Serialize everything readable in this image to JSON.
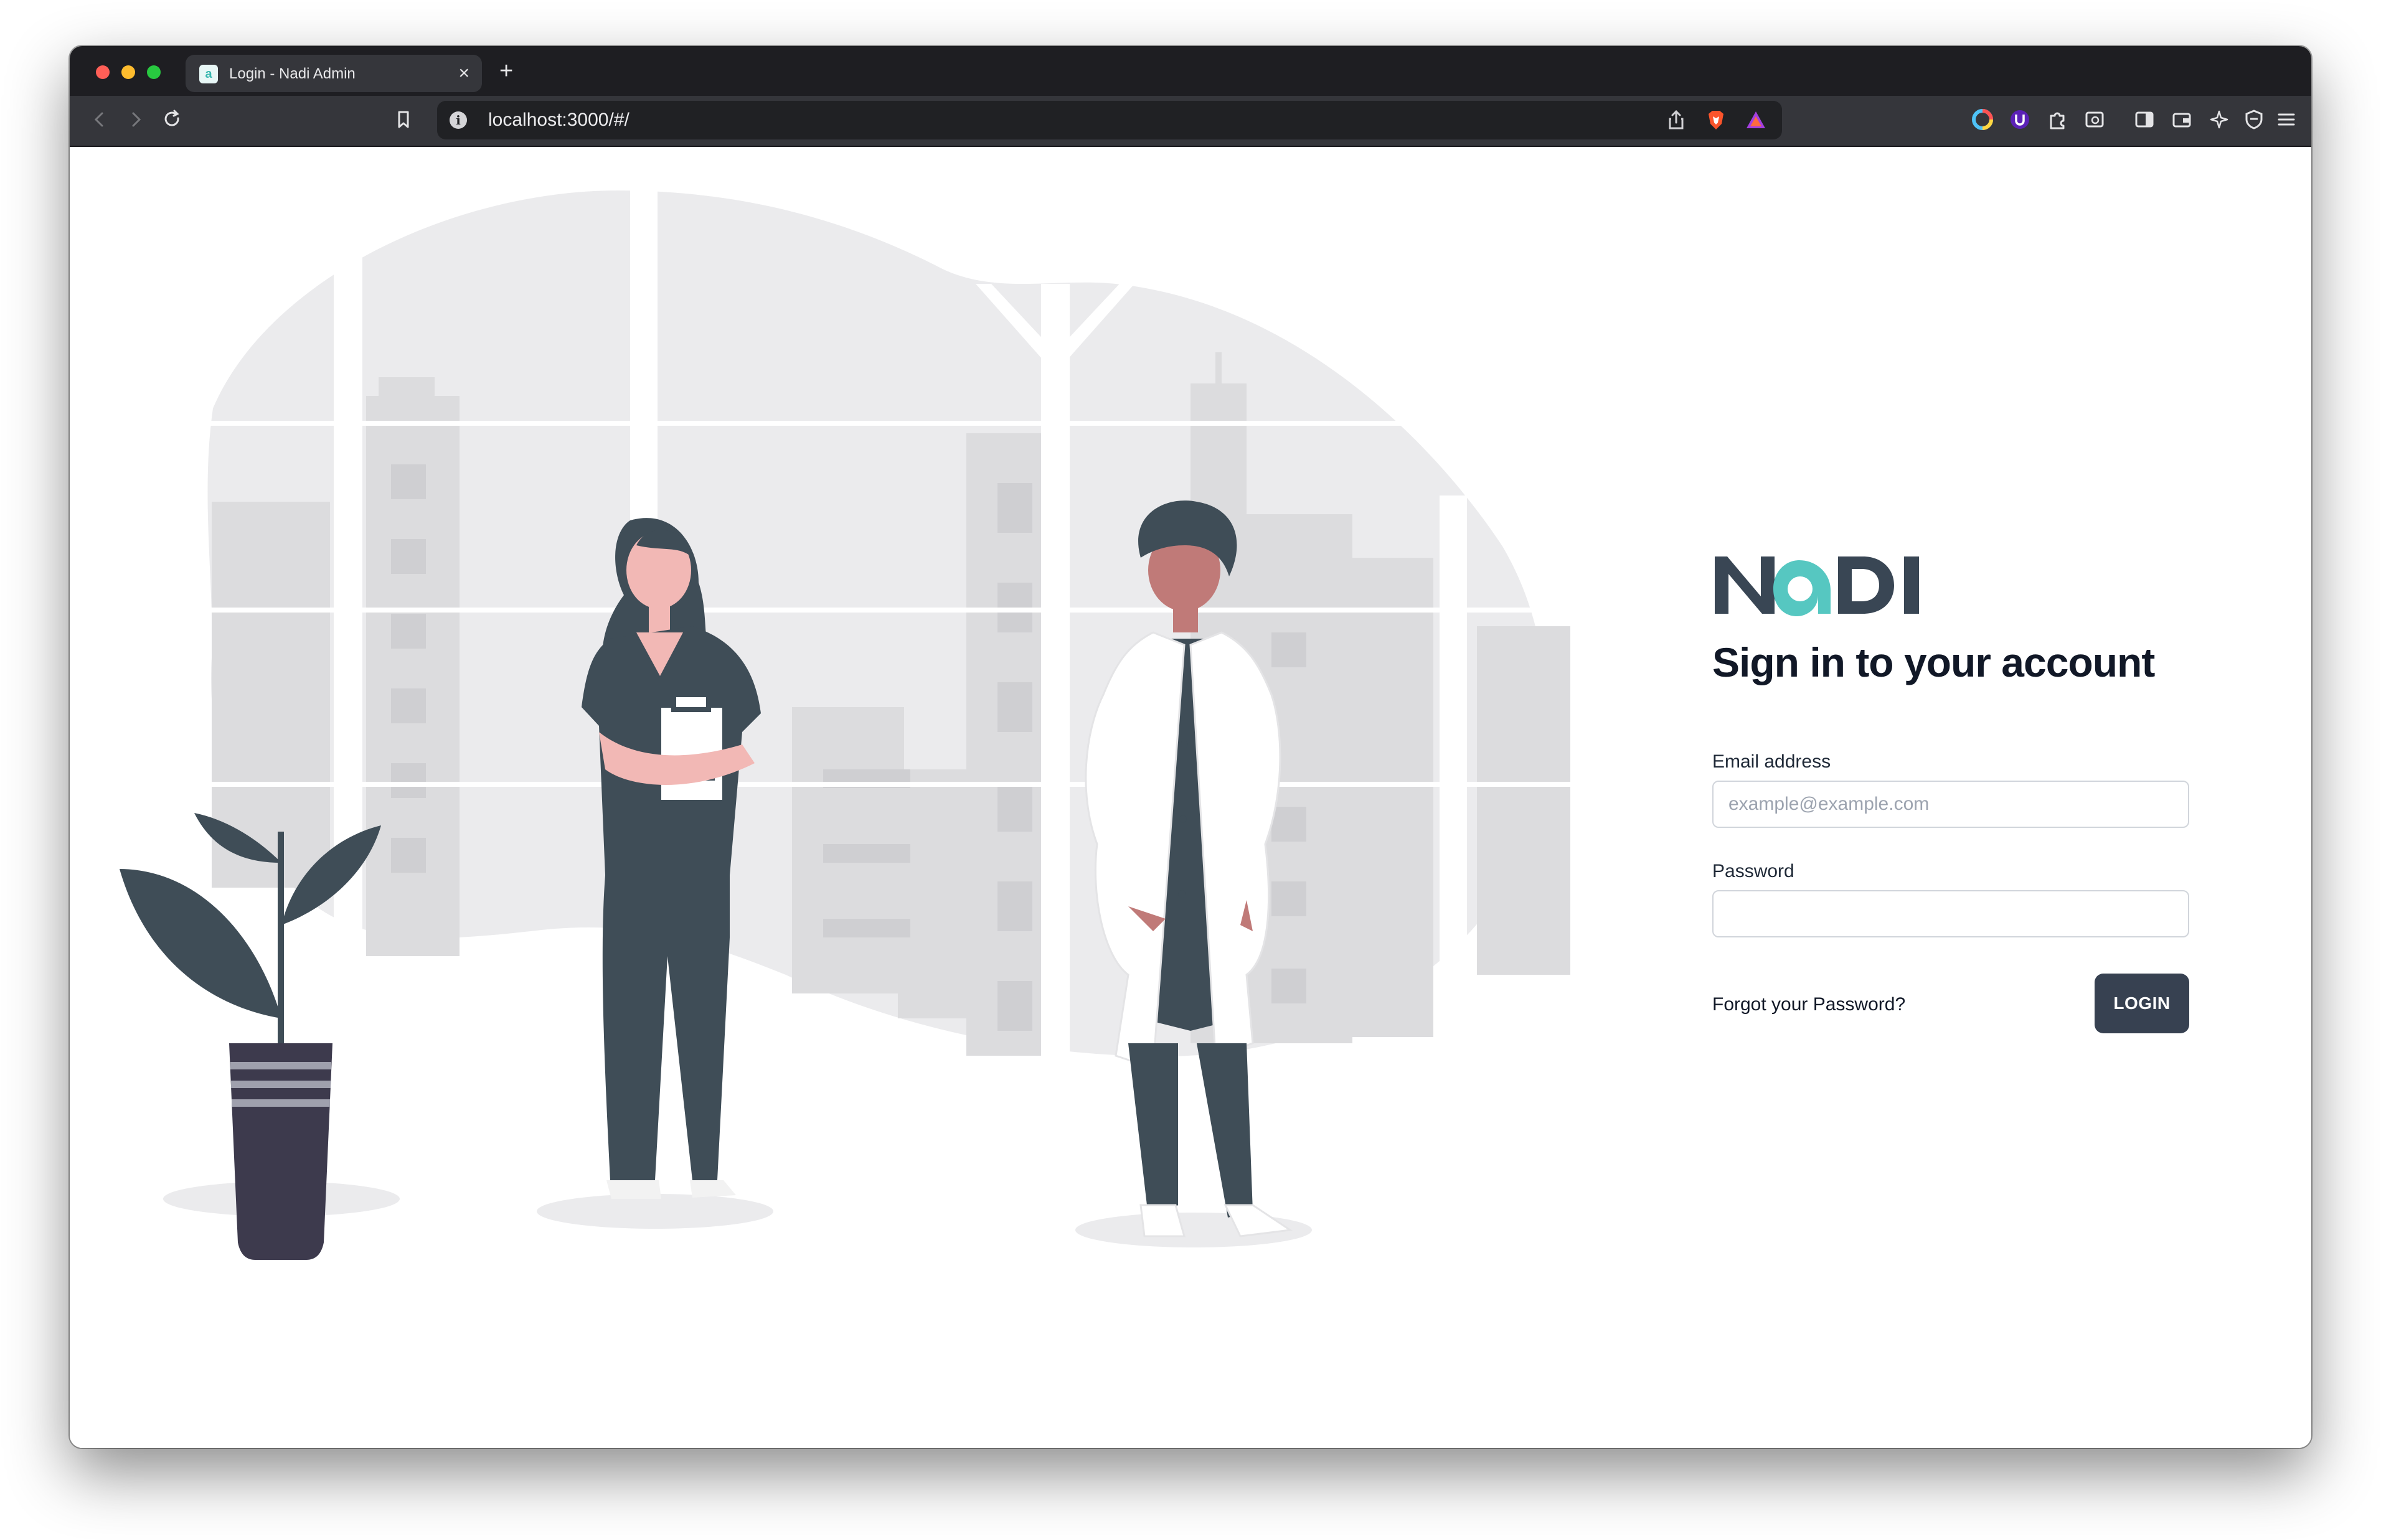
{
  "browser": {
    "tab": {
      "title": "Login - Nadi Admin",
      "close_glyph": "×"
    },
    "new_tab_glyph": "+",
    "url": "localhost:3000/#/",
    "url_info_glyph": "i"
  },
  "app": {
    "logo": {
      "text": "NaDI",
      "dark_color": "#394654",
      "accent_color": "#56c7c1"
    },
    "heading": "Sign in to your account",
    "email": {
      "label": "Email address",
      "placeholder": "example@example.com",
      "value": ""
    },
    "password": {
      "label": "Password",
      "value": ""
    },
    "forgot_link": "Forgot your Password?",
    "login_button": "LOGIN"
  },
  "colors": {
    "primary_button": "#374151",
    "illustration_dark": "#3f4d57",
    "illustration_skin_1": "#f2b8b5",
    "illustration_skin_2": "#c07a78",
    "background_city": "#ebebed"
  }
}
